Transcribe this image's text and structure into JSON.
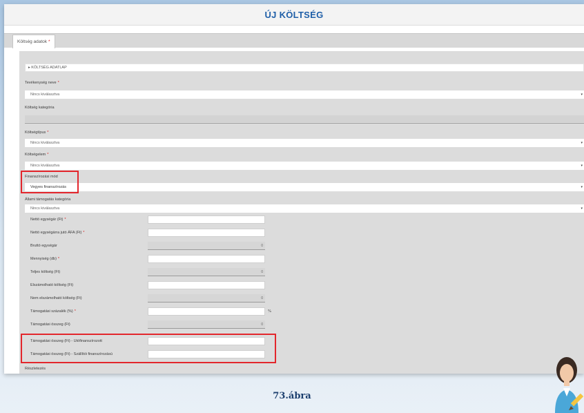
{
  "title": "ÚJ KÖLTSÉG",
  "tab": {
    "label": "Költség adatok",
    "required": "*"
  },
  "section": {
    "label": "▸ KÖLTSÉG ADATLAP"
  },
  "fields": {
    "tevekenyseg": {
      "label": "Tevékenység neve",
      "required": "*",
      "value": "Nincs kiválasztva"
    },
    "kategoria": {
      "label": "Költség kategória"
    },
    "tipus": {
      "label": "Költségtípus",
      "required": "*",
      "value": "Nincs kiválasztva"
    },
    "elem": {
      "label": "Költségelem",
      "required": "*",
      "value": "Nincs kiválasztva"
    },
    "finanszirozas": {
      "label": "Finanszírozási mód",
      "value": "Vegyes finanszírozás"
    },
    "allami": {
      "label": "Állami támogatás kategória",
      "value": "Nincs kiválasztva"
    }
  },
  "rows": [
    {
      "label": "Nettó egységár (Ft)",
      "required": "*",
      "value": ""
    },
    {
      "label": "Nettó egységárra jutó ÁFA (Ft)",
      "required": "*",
      "value": ""
    },
    {
      "label": "Bruttó egységár",
      "required": "",
      "value": "0"
    },
    {
      "label": "Mennyiség (db)",
      "required": "*",
      "value": ""
    },
    {
      "label": "Teljes költség (Ft)",
      "required": "",
      "value": "0"
    },
    {
      "label": "Elszámolható költség (Ft)",
      "required": "",
      "value": ""
    },
    {
      "label": "Nem elszámolható költség (Ft)",
      "required": "",
      "value": "0"
    },
    {
      "label": "Támogatási százalék (%)",
      "required": "*",
      "value": "",
      "unit": "%"
    },
    {
      "label": "Támogatási összeg (Ft)",
      "required": "",
      "value": "0"
    },
    {
      "label": "Támogatási összeg (Ft)   - Utófinanszírozott",
      "required": "",
      "value": ""
    },
    {
      "label": "Támogatási összeg (Ft) - Szállítói finanszírozású",
      "required": "",
      "value": ""
    }
  ],
  "reszletezes": {
    "label": "Részletezés"
  },
  "caption": "73.ábra",
  "icons": {
    "avatar": "user-avatar-pencil-icon",
    "dropdown": "chevron-down-icon"
  },
  "colors": {
    "title": "#1f5fa8",
    "highlight": "#e3262c",
    "required": "#d61b1b"
  }
}
